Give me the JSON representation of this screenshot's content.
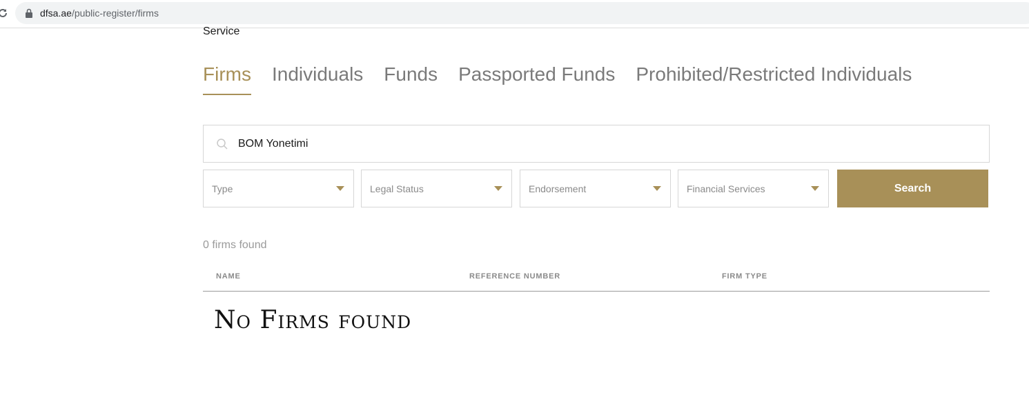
{
  "browser": {
    "url_domain": "dfsa.ae",
    "url_path": "/public-register/firms"
  },
  "page": {
    "service_text": "Service",
    "tabs": [
      {
        "label": "Firms",
        "active": true
      },
      {
        "label": "Individuals",
        "active": false
      },
      {
        "label": "Funds",
        "active": false
      },
      {
        "label": "Passported Funds",
        "active": false
      },
      {
        "label": "Prohibited/Restricted Individuals",
        "active": false
      }
    ],
    "search": {
      "value": "BOM Yonetimi",
      "icon": "search-icon"
    },
    "filters": {
      "type": "Type",
      "legal_status": "Legal Status",
      "endorsement": "Endorsement",
      "financial_services": "Financial Services"
    },
    "search_button": "Search",
    "results_count": "0 firms found",
    "table": {
      "columns": [
        "NAME",
        "REFERENCE NUMBER",
        "FIRM TYPE"
      ]
    },
    "no_results": "No Firms found"
  },
  "colors": {
    "accent": "#a89058",
    "muted_text": "#8a8a8a",
    "border": "#d6d6d6"
  }
}
